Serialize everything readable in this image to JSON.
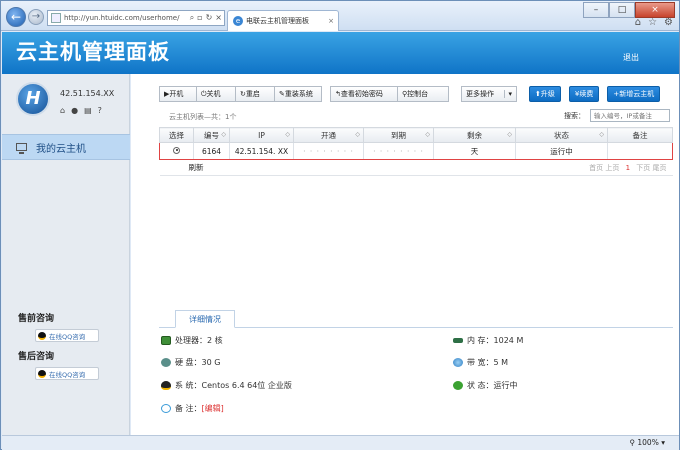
{
  "browser": {
    "address": "http://yun.htuidc.com/userhome/",
    "tab_title": "电联云主机管理面板",
    "zoom": "100%"
  },
  "header": {
    "logo": "云主机管理面板",
    "logout": "退出"
  },
  "sidebar": {
    "ip": "42.51.154.XX",
    "menu_item": "我的云主机",
    "presales_title": "售前咨询",
    "presales_btn": "在线QQ咨询",
    "aftersales_title": "售后咨询",
    "aftersales_btn": "在线QQ咨询"
  },
  "toolbar": {
    "start": "▶开机",
    "shutdown": "关机",
    "restart": "重启",
    "reinstall": "重装系统",
    "view_password": "查看初始密码",
    "console": "控制台",
    "more": "更多操作",
    "upgrade": "升级",
    "renew": "续费",
    "new_host": "新增云主机"
  },
  "list": {
    "info": "云主机列表—共：1个",
    "search_label": "搜索：",
    "search_placeholder": "输入编号，IP或备注",
    "columns": [
      "选择",
      "编号",
      "IP",
      "开通",
      "到期",
      "剩余",
      "状态",
      "备注"
    ],
    "row": {
      "id": "6164",
      "ip": "42.51.154. XX",
      "opened": "· · · · · · · ·",
      "expires": "· · · · · · · ·",
      "remaining": "天",
      "status": "运行中",
      "note": ""
    },
    "refresh": "刷新",
    "pager": {
      "first": "首页",
      "prev": "上页",
      "current": "1",
      "next": "下页",
      "last": "尾页"
    }
  },
  "details": {
    "tab": "详细情况",
    "cpu": "处理器：2 核",
    "disk": "硬 盘：30 G",
    "os": "系 统：Centos 6.4 64位 企业版",
    "note_label": "备 注：",
    "note_edit": "[编辑]",
    "memory": "内 存：1024 M",
    "bandwidth": "带 宽：5 M",
    "status": "状 态：运行中"
  }
}
